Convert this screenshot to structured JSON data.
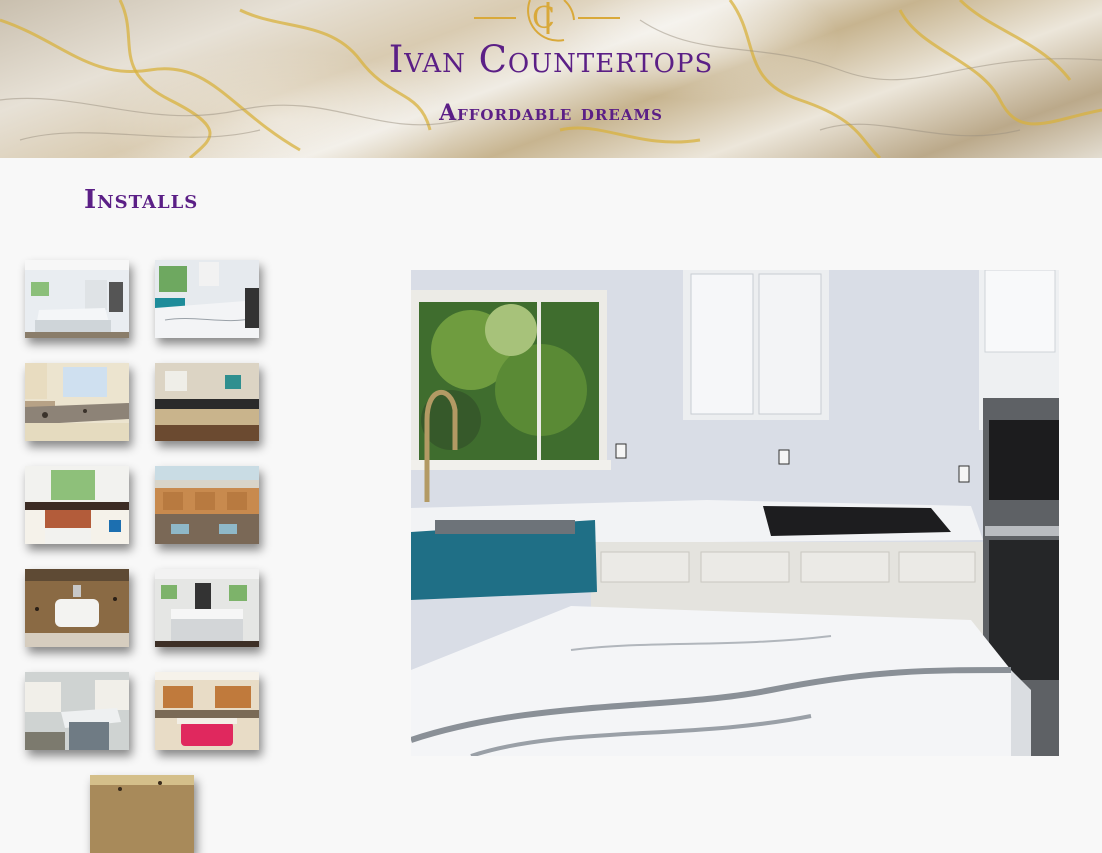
{
  "header": {
    "brand": "Ivan Countertops",
    "tagline": "Affordable dreams",
    "logo_icon": "ic-monogram-icon",
    "accent_color": "#5b1f86",
    "gold_color": "#d9a93a"
  },
  "gallery": {
    "title": "Installs",
    "thumbnails": [
      {
        "name": "install-white-island-kitchen"
      },
      {
        "name": "install-window-quartz-corner"
      },
      {
        "name": "install-granite-sink-window"
      },
      {
        "name": "install-dark-top-open-kitchen"
      },
      {
        "name": "install-copper-sink-dark-counter"
      },
      {
        "name": "install-wood-cabinets-long-counter"
      },
      {
        "name": "install-granite-vanity-sink"
      },
      {
        "name": "install-white-island-living"
      },
      {
        "name": "install-gray-peninsula"
      },
      {
        "name": "install-wood-kitchen-pink-island"
      },
      {
        "name": "install-granite-partial"
      }
    ],
    "main_image": {
      "name": "featured-install-white-quartz-island"
    }
  }
}
